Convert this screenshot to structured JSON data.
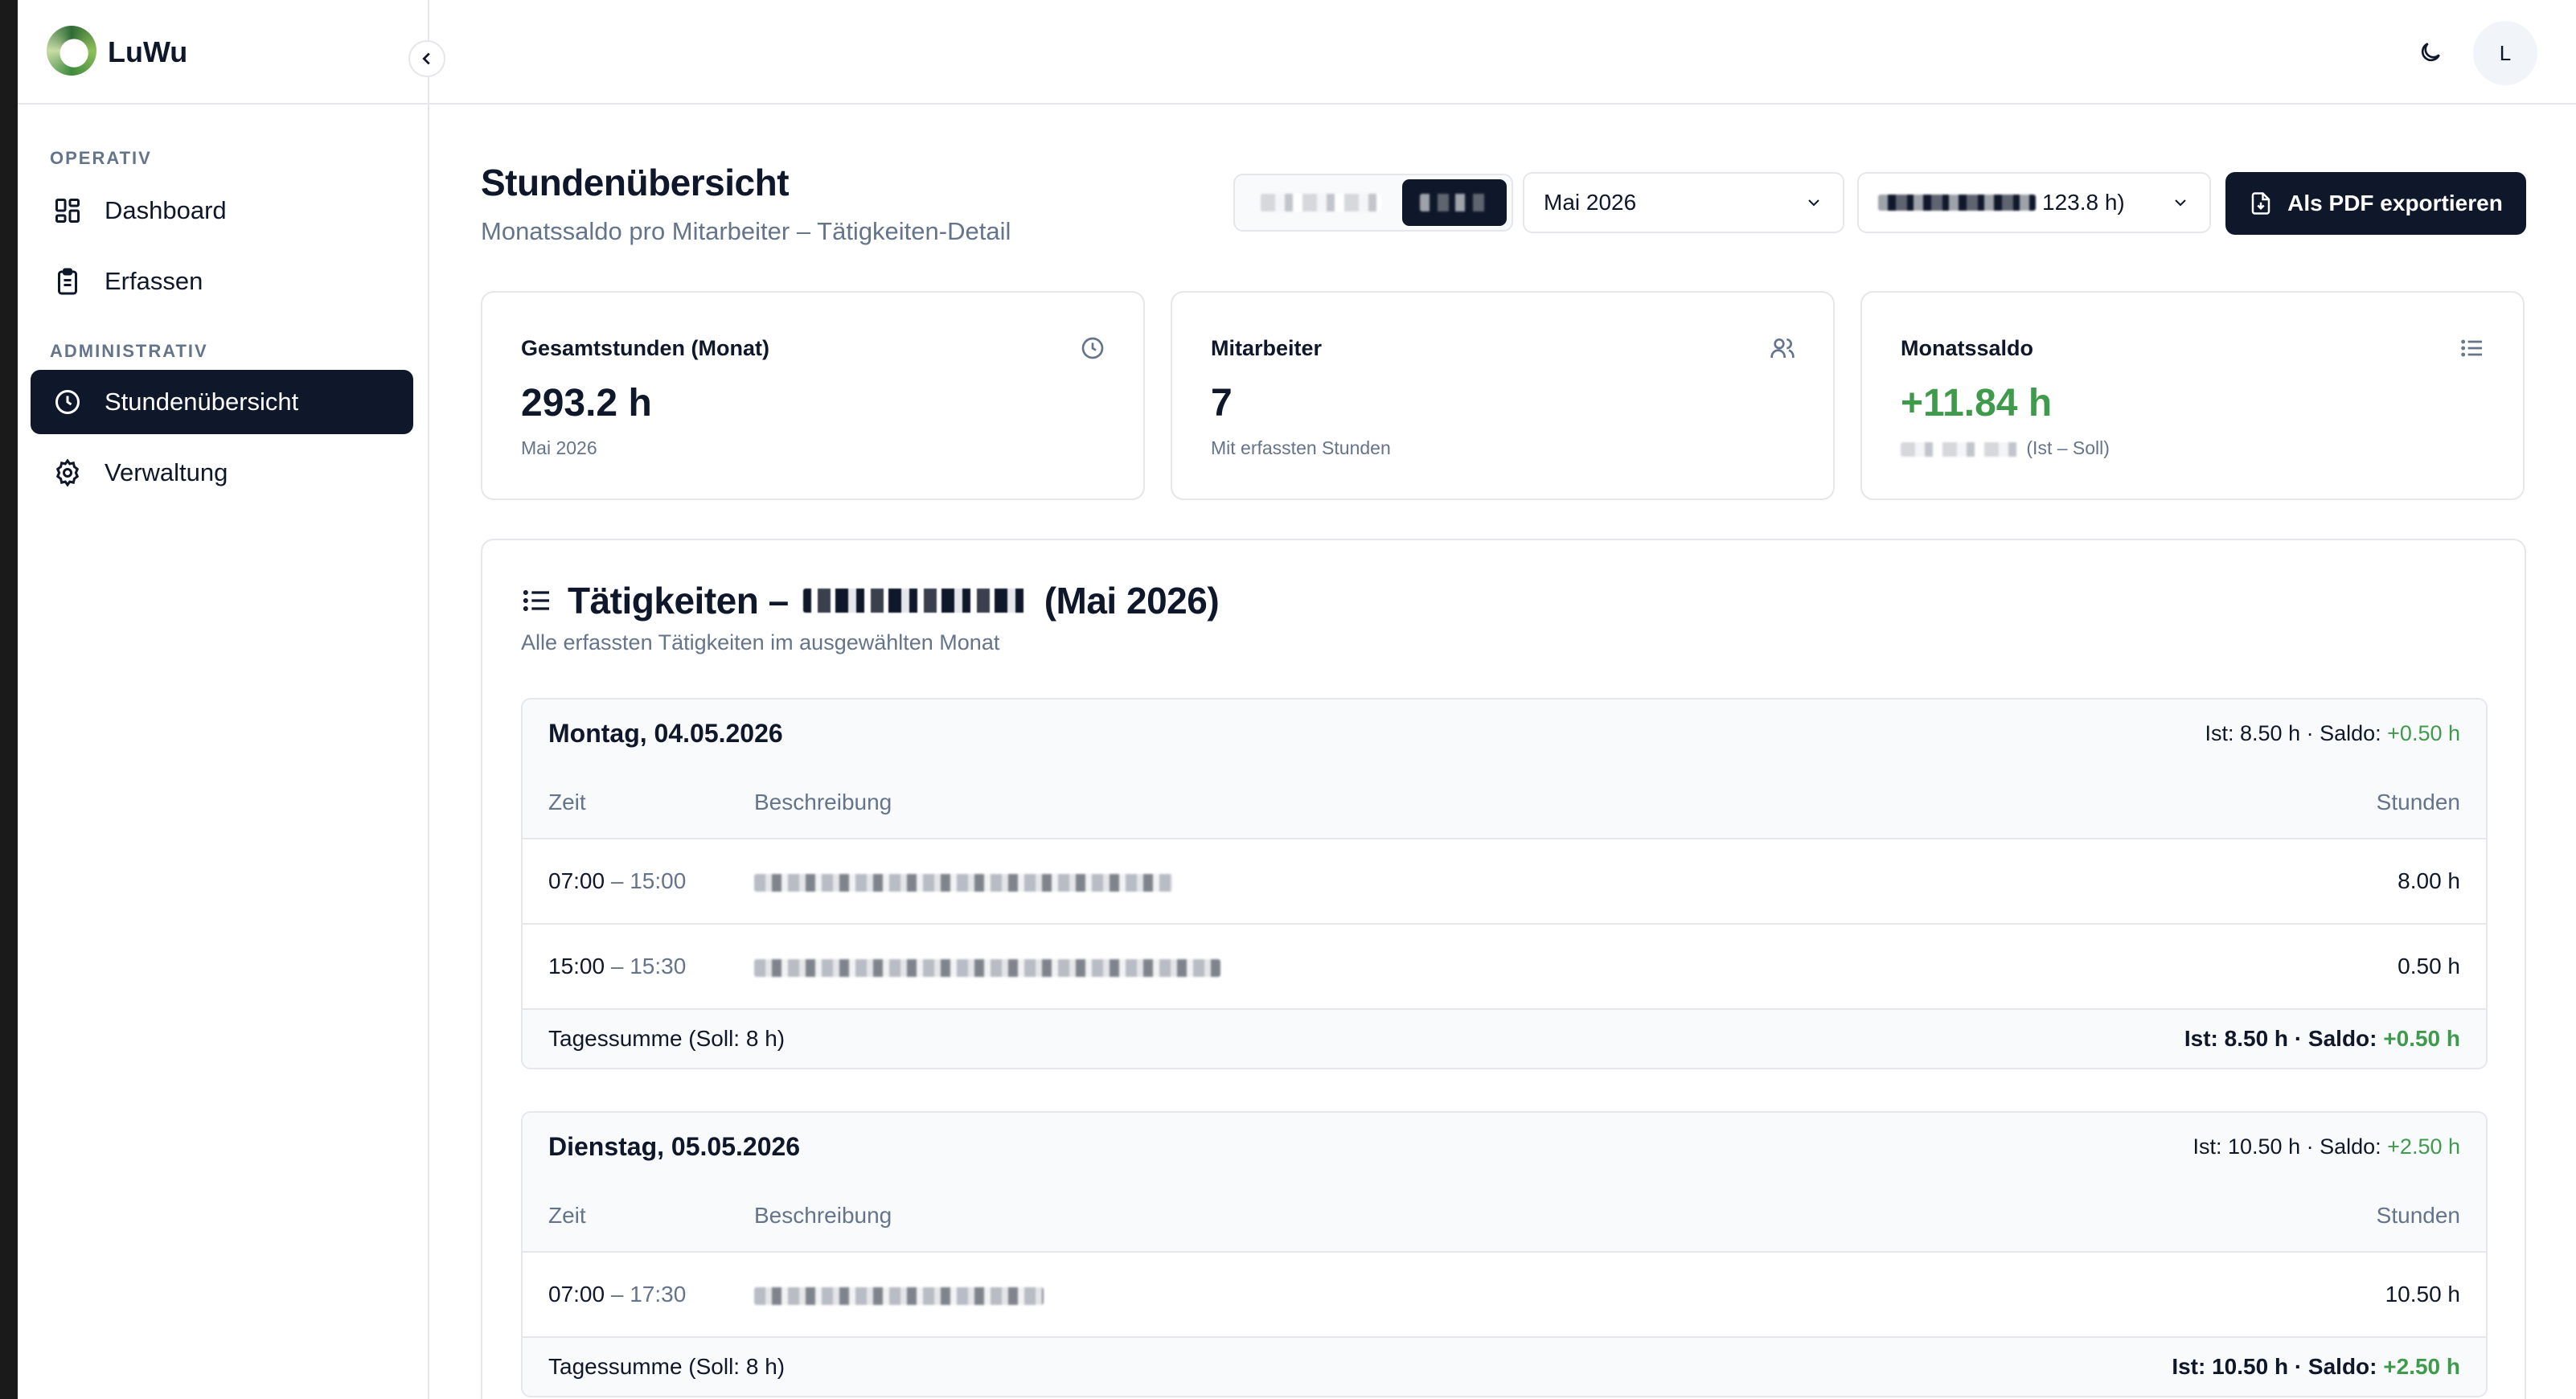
{
  "app": {
    "name": "LuWu",
    "user_initial": "L"
  },
  "sidebar": {
    "sections": [
      {
        "label": "OPERATIV",
        "items": [
          {
            "label": "Dashboard",
            "icon": "dashboard-icon",
            "active": false
          },
          {
            "label": "Erfassen",
            "icon": "clipboard-icon",
            "active": false
          }
        ]
      },
      {
        "label": "ADMINISTRATIV",
        "items": [
          {
            "label": "Stundenübersicht",
            "icon": "clock-icon",
            "active": true
          },
          {
            "label": "Verwaltung",
            "icon": "gear-icon",
            "active": false
          }
        ]
      }
    ]
  },
  "page": {
    "title": "Stundenübersicht",
    "subtitle": "Monatssaldo pro Mitarbeiter – Tätigkeiten-Detail"
  },
  "filters": {
    "month_select": "Mai 2026",
    "person_select_suffix": "123.8 h)",
    "export_label": "Als PDF exportieren"
  },
  "stats": [
    {
      "label": "Gesamtstunden (Monat)",
      "value": "293.2 h",
      "sub": "Mai 2026",
      "icon": "clock-icon"
    },
    {
      "label": "Mitarbeiter",
      "value": "7",
      "sub": "Mit erfassten Stunden",
      "icon": "users-icon"
    },
    {
      "label": "Monatssaldo",
      "value": "+11.84 h",
      "sub": "(Ist – Soll)",
      "icon": "list-icon"
    }
  ],
  "activities": {
    "title_prefix": "Tätigkeiten –",
    "title_suffix": "(Mai 2026)",
    "subtitle": "Alle erfassten Tätigkeiten im ausgewählten Monat",
    "columns": {
      "time": "Zeit",
      "desc": "Beschreibung",
      "hours": "Stunden"
    },
    "days": [
      {
        "title": "Montag, 04.05.2026",
        "summary_prefix": "Ist: 8.50 h · Saldo:",
        "summary_saldo": "+0.50 h",
        "rows": [
          {
            "start": "07:00",
            "end": "– 15:00",
            "hours": "8.00 h"
          },
          {
            "start": "15:00",
            "end": "– 15:30",
            "hours": "0.50 h"
          }
        ],
        "footer_label": "Tagessumme (Soll: 8 h)",
        "footer_prefix": "Ist: 8.50 h · Saldo:",
        "footer_saldo": "+0.50 h"
      },
      {
        "title": "Dienstag, 05.05.2026",
        "summary_prefix": "Ist: 10.50 h · Saldo:",
        "summary_saldo": "+2.50 h",
        "rows": [
          {
            "start": "07:00",
            "end": "– 17:30",
            "hours": "10.50 h"
          }
        ],
        "footer_label": "Tagessumme (Soll: 8 h)",
        "footer_prefix": "Ist: 10.50 h · Saldo:",
        "footer_saldo": "+2.50 h"
      }
    ]
  },
  "colors": {
    "primary": "#0f172a",
    "muted": "#64748b",
    "positive": "#3f9a4c",
    "border": "#e5e7eb"
  }
}
